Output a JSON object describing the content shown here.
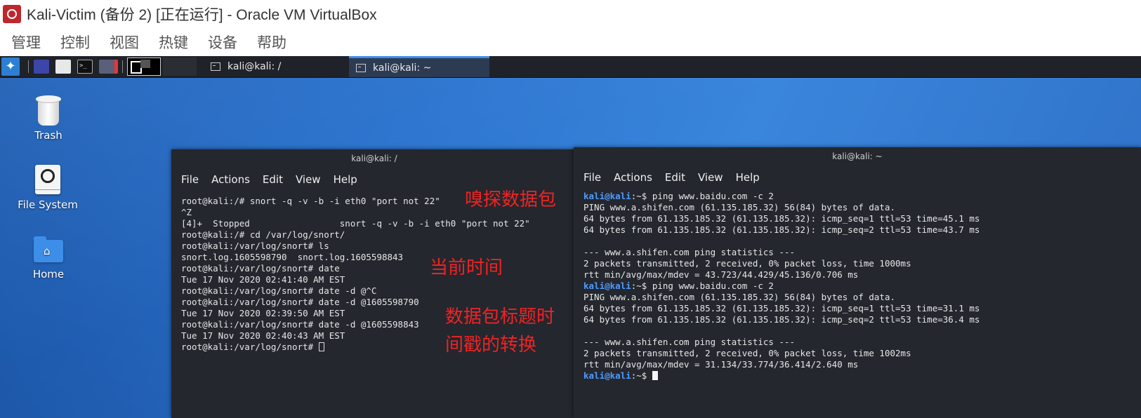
{
  "vbox": {
    "title": "Kali-Victim (备份 2) [正在运行] - Oracle VM VirtualBox",
    "menu": [
      "管理",
      "控制",
      "视图",
      "热键",
      "设备",
      "帮助"
    ]
  },
  "taskbar": {
    "tasks": [
      {
        "label": "kali@kali: /",
        "active": false
      },
      {
        "label": "kali@kali: ~",
        "active": true
      }
    ]
  },
  "desktop": {
    "icons": [
      {
        "label": "Trash"
      },
      {
        "label": "File System"
      },
      {
        "label": "Home"
      }
    ]
  },
  "terminal_left": {
    "title": "kali@kali: /",
    "menu": [
      "File",
      "Actions",
      "Edit",
      "View",
      "Help"
    ],
    "lines": [
      "root@kali:/# snort -q -v -b -i eth0 \"port not 22\"",
      "^Z",
      "[4]+  Stopped                 snort -q -v -b -i eth0 \"port not 22\"",
      "root@kali:/# cd /var/log/snort/",
      "root@kali:/var/log/snort# ls",
      "snort.log.1605598790  snort.log.1605598843",
      "root@kali:/var/log/snort# date",
      "Tue 17 Nov 2020 02:41:40 AM EST",
      "root@kali:/var/log/snort# date -d @^C",
      "root@kali:/var/log/snort# date -d @1605598790",
      "Tue 17 Nov 2020 02:39:50 AM EST",
      "root@kali:/var/log/snort# date -d @1605598843",
      "Tue 17 Nov 2020 02:40:43 AM EST",
      "root@kali:/var/log/snort# "
    ],
    "annotations": [
      "嗅探数据包",
      "当前时间",
      "数据包标题时",
      "间戳的转换"
    ]
  },
  "terminal_right": {
    "title": "kali@kali: ~",
    "menu": [
      "File",
      "Actions",
      "Edit",
      "View",
      "Help"
    ],
    "prompt_user": "kali@kali",
    "prompt_suffix": ":~$ ",
    "cmd1": "ping www.baidu.com -c 2",
    "out1": [
      "PING www.a.shifen.com (61.135.185.32) 56(84) bytes of data.",
      "64 bytes from 61.135.185.32 (61.135.185.32): icmp_seq=1 ttl=53 time=45.1 ms",
      "64 bytes from 61.135.185.32 (61.135.185.32): icmp_seq=2 ttl=53 time=43.7 ms",
      "",
      "--- www.a.shifen.com ping statistics ---",
      "2 packets transmitted, 2 received, 0% packet loss, time 1000ms",
      "rtt min/avg/max/mdev = 43.723/44.429/45.136/0.706 ms"
    ],
    "cmd2": "ping www.baidu.com -c 2",
    "out2": [
      "PING www.a.shifen.com (61.135.185.32) 56(84) bytes of data.",
      "64 bytes from 61.135.185.32 (61.135.185.32): icmp_seq=1 ttl=53 time=31.1 ms",
      "64 bytes from 61.135.185.32 (61.135.185.32): icmp_seq=2 ttl=53 time=36.4 ms",
      "",
      "--- www.a.shifen.com ping statistics ---",
      "2 packets transmitted, 2 received, 0% packet loss, time 1002ms",
      "rtt min/avg/max/mdev = 31.134/33.774/36.414/2.640 ms"
    ]
  }
}
